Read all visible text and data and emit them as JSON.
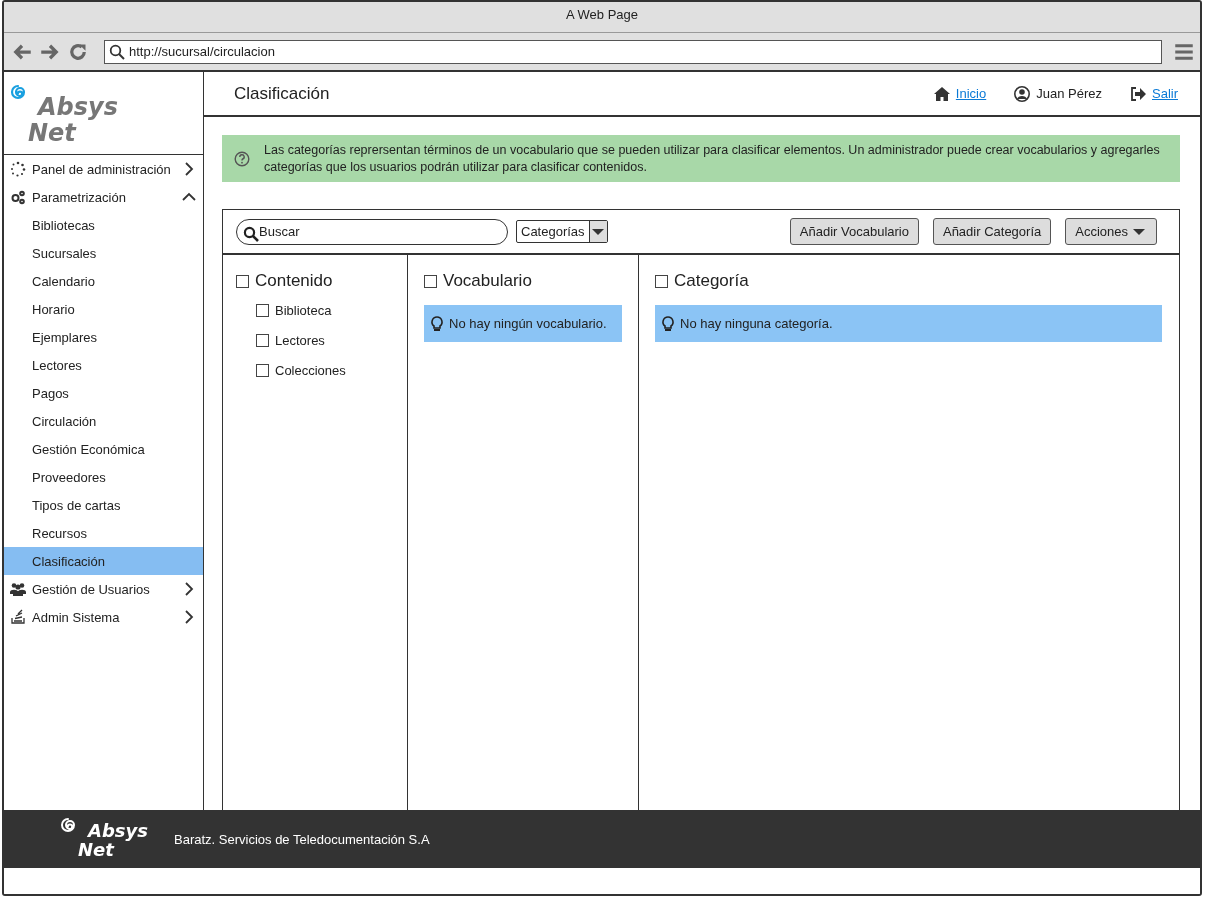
{
  "window": {
    "title": "A Web Page",
    "url": "http://sucursal/circulacion"
  },
  "logo": {
    "line_1": "Absys",
    "line_2": "Net"
  },
  "sidebar": {
    "items": [
      {
        "label": "Panel de administración",
        "expanded": false,
        "selected": false
      },
      {
        "label": "Parametrización",
        "expanded": true,
        "selected": false,
        "children": [
          {
            "label": "Bibliotecas",
            "selected": false
          },
          {
            "label": "Sucursales",
            "selected": false
          },
          {
            "label": "Calendario",
            "selected": false
          },
          {
            "label": "Horario",
            "selected": false
          },
          {
            "label": "Ejemplares",
            "selected": false
          },
          {
            "label": "Lectores",
            "selected": false
          },
          {
            "label": "Pagos",
            "selected": false
          },
          {
            "label": "Circulación",
            "selected": false
          },
          {
            "label": "Gestión Económica",
            "selected": false
          },
          {
            "label": "Proveedores",
            "selected": false
          },
          {
            "label": "Tipos de cartas",
            "selected": false
          },
          {
            "label": "Recursos",
            "selected": false
          },
          {
            "label": "Clasificación",
            "selected": true
          }
        ]
      },
      {
        "label": "Gestión de Usuarios",
        "expanded": false,
        "selected": false
      },
      {
        "label": "Admin Sistema",
        "expanded": false,
        "selected": false
      }
    ]
  },
  "header": {
    "title": "Clasificación",
    "home_link": "Inicio",
    "user": "Juan Pérez",
    "logout_link": "Salir"
  },
  "info": "Las categorías reprersentan términos de un vocabulario que se pueden utilizar para clasificar elementos. Un administrador puede crear vocabularios y agregarles categorías que los usuarios podrán utilizar para clasificar contenidos.",
  "toolbar": {
    "search": {
      "placeholder": "Buscar"
    },
    "filter": "Categorías",
    "buttons": [
      "Añadir Vocabulario",
      "Añadir Categoría"
    ],
    "menu_button": "Acciones"
  },
  "columns": [
    {
      "title": "Contenido",
      "checked": false,
      "items": [
        {
          "label": "Biblioteca",
          "checked": false
        },
        {
          "label": "Lectores",
          "checked": false
        },
        {
          "label": "Colecciones",
          "checked": false
        }
      ]
    },
    {
      "title": "Vocabulario",
      "checked": false,
      "message": "No hay ningún vocabulario."
    },
    {
      "title": "Categoría",
      "checked": false,
      "message": "No hay ninguna categoría."
    }
  ],
  "footer": {
    "logo_line_1": "Absys",
    "logo_line_2": "Net",
    "company": "Baratz. Servicios de Teledocumentación S.A"
  }
}
